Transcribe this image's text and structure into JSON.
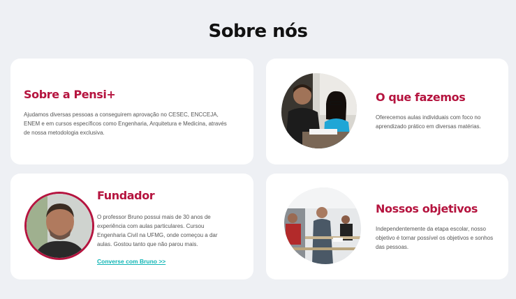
{
  "header": {
    "title": "Sobre nós"
  },
  "cards": {
    "about": {
      "title": "Sobre a Pensi+",
      "text": "Ajudamos diversas pessoas a conseguirem aprovação no CESEC, ENCCEJA, ENEM e em cursos específicos como Engenharia, Arquitetura e Medicina, através de nossa metodologia exclusiva."
    },
    "what_we_do": {
      "title": "O que fazemos",
      "text": "Oferecemos aulas individuais com foco no aprendizado prático em diversas matérias."
    },
    "founder": {
      "title": "Fundador",
      "text": "O professor Bruno possui mais de 30 anos de experiência com aulas particulares. Cursou Engenharia Civil na UFMG, onde começou a dar aulas. Gostou tanto que não parou mais.",
      "link": "Converse com Bruno >>"
    },
    "goals": {
      "title": "Nossos objetivos",
      "text": "Independentemente da etapa escolar, nosso objetivo é tornar possível os objetivos e sonhos das pessoas."
    }
  },
  "colors": {
    "accent": "#b5143f",
    "link": "#0fb5b5",
    "background": "#eef0f4"
  }
}
